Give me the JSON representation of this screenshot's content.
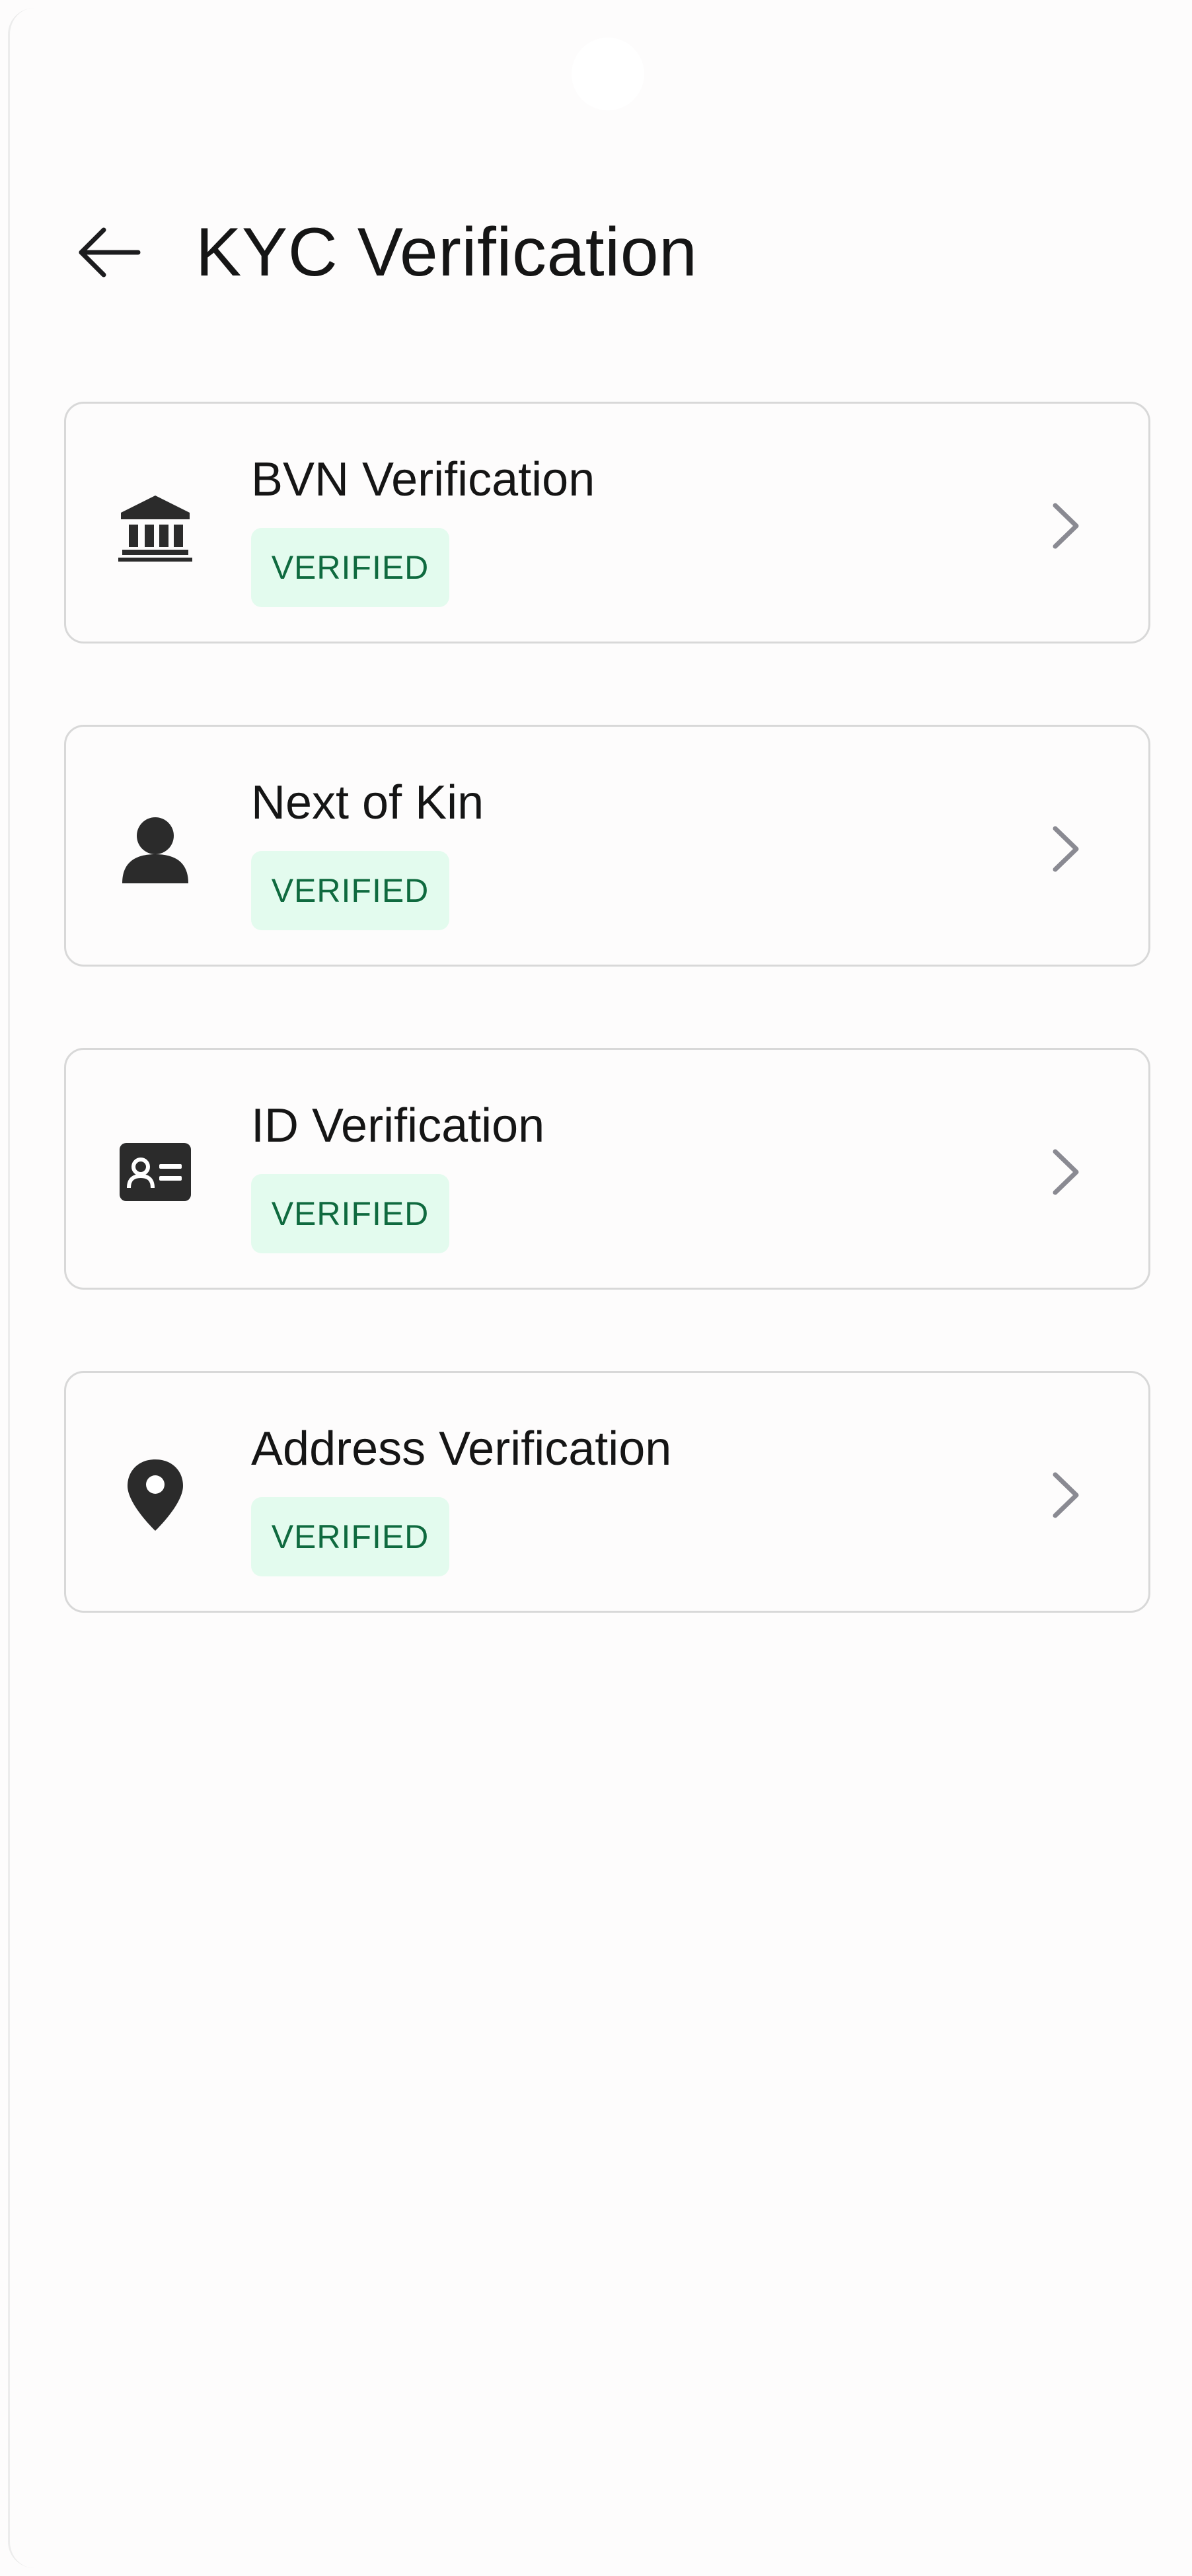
{
  "header": {
    "title": "KYC Verification",
    "back_icon": "arrow-left-icon"
  },
  "items": [
    {
      "title": "BVN Verification",
      "status": "VERIFIED",
      "icon": "bank-icon"
    },
    {
      "title": "Next of Kin",
      "status": "VERIFIED",
      "icon": "person-icon"
    },
    {
      "title": "ID Verification",
      "status": "VERIFIED",
      "icon": "id-card-icon"
    },
    {
      "title": "Address Verification",
      "status": "VERIFIED",
      "icon": "location-pin-icon"
    }
  ],
  "colors": {
    "background": "#fdfcfc",
    "card_border": "#d8d8d8",
    "badge_background": "#e3fbee",
    "badge_text": "#0f6a3f",
    "icon": "#2b2b2b",
    "chevron": "#8a8a92"
  }
}
